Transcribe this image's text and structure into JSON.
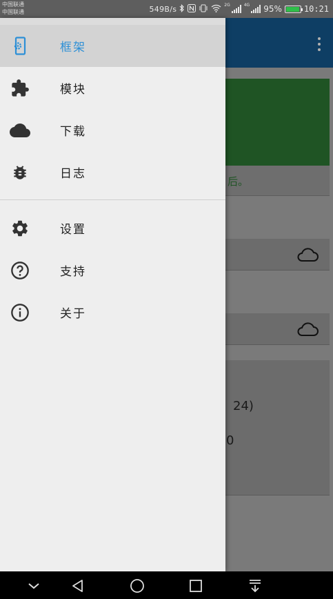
{
  "status_bar": {
    "carrier_1": "中国联通",
    "carrier_2": "中国联通",
    "net_speed": "549B/s",
    "net_tag_1": "2G",
    "net_tag_2": "4G",
    "battery": "95%",
    "time": "10:21"
  },
  "background": {
    "card_text": "后。",
    "info_line_1": "24)",
    "info_line_2": "0"
  },
  "drawer": {
    "items": [
      {
        "label": "框架",
        "icon": "framework-icon",
        "active": true
      },
      {
        "label": "模块",
        "icon": "puzzle-icon"
      },
      {
        "label": "下载",
        "icon": "cloud-icon"
      },
      {
        "label": "日志",
        "icon": "bug-icon"
      }
    ],
    "secondary_items": [
      {
        "label": "设置",
        "icon": "gear-icon"
      },
      {
        "label": "支持",
        "icon": "help-icon"
      },
      {
        "label": "关于",
        "icon": "info-icon"
      }
    ]
  },
  "colors": {
    "accent": "#2c8fd6",
    "toolbar": "#0e3e64",
    "card_green": "#1f5424"
  }
}
